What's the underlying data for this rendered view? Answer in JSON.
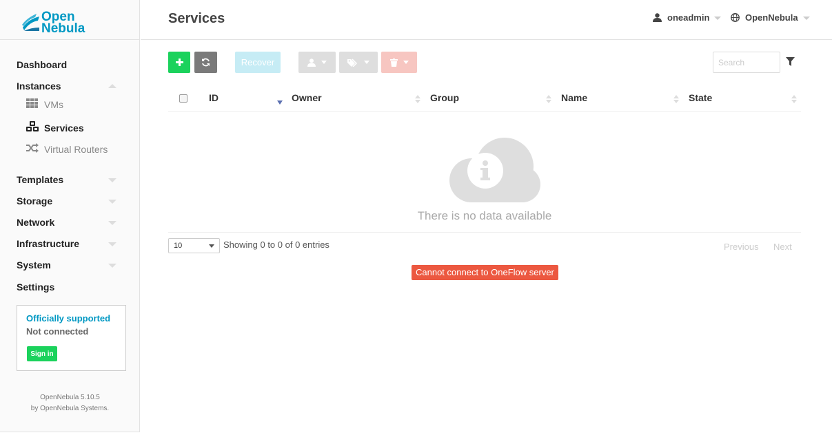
{
  "brand": {
    "line1": "Open",
    "line2": "Nebula"
  },
  "header": {
    "title": "Services",
    "user": "oneadmin",
    "zone": "OpenNebula"
  },
  "sidebar": {
    "items": [
      {
        "label": "Dashboard"
      },
      {
        "label": "Instances"
      },
      {
        "label": "Templates"
      },
      {
        "label": "Storage"
      },
      {
        "label": "Network"
      },
      {
        "label": "Infrastructure"
      },
      {
        "label": "System"
      },
      {
        "label": "Settings"
      }
    ],
    "subitems": [
      {
        "label": "VMs",
        "icon": "grid-icon"
      },
      {
        "label": "Services",
        "icon": "cubes-icon",
        "active": true
      },
      {
        "label": "Virtual Routers",
        "icon": "shuffle-icon"
      }
    ],
    "support": {
      "title": "Officially supported",
      "status": "Not connected",
      "signin": "Sign in"
    },
    "version": {
      "line1": "OpenNebula 5.10.5",
      "line2": "by OpenNebula Systems."
    }
  },
  "toolbar": {
    "recover_label": "Recover",
    "search_placeholder": "Search"
  },
  "table": {
    "columns": [
      "ID",
      "Owner",
      "Group",
      "Name",
      "State"
    ],
    "empty_message": "There is no data available",
    "page_length": "10",
    "info": "Showing 0 to 0 of 0 entries",
    "prev": "Previous",
    "next": "Next"
  },
  "error_message": "Cannot connect to OneFlow server",
  "colors": {
    "accent": "#0098c3",
    "create": "#1bd25c",
    "error": "#ec5840"
  }
}
